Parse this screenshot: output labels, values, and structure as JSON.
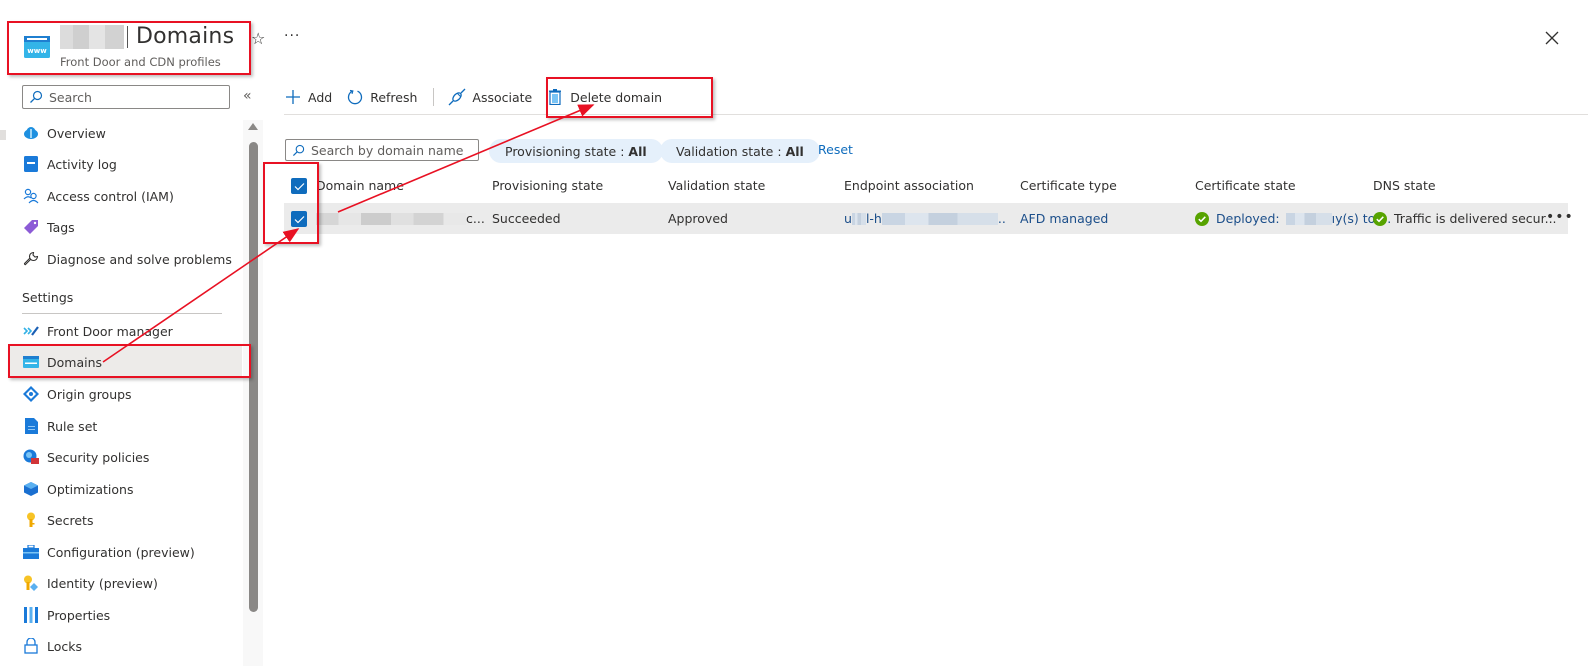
{
  "header": {
    "title": "Domains",
    "subtitle": "Front Door and CDN profiles",
    "resource_icon": "www-domain-icon",
    "favorite_icon": "star-icon",
    "more_icon": "ellipsis-icon",
    "close_icon": "close-icon",
    "favorite_glyph": "☆",
    "more_glyph": "···"
  },
  "sidebar": {
    "search_placeholder": "Search",
    "collapse_glyph": "«",
    "items": [
      {
        "label": "Overview",
        "icon": "cloud-icon"
      },
      {
        "label": "Activity log",
        "icon": "activity-log-icon"
      },
      {
        "label": "Access control (IAM)",
        "icon": "people-icon"
      },
      {
        "label": "Tags",
        "icon": "tag-icon"
      },
      {
        "label": "Diagnose and solve problems",
        "icon": "wrench-icon"
      }
    ],
    "section_settings": "Settings",
    "settings_items": [
      {
        "label": "Front Door manager",
        "icon": "front-door-icon"
      },
      {
        "label": "Domains",
        "icon": "www-domain-icon",
        "active": true
      },
      {
        "label": "Origin groups",
        "icon": "origin-groups-icon"
      },
      {
        "label": "Rule set",
        "icon": "document-icon"
      },
      {
        "label": "Security policies",
        "icon": "security-globe-icon"
      },
      {
        "label": "Optimizations",
        "icon": "cube-icon"
      },
      {
        "label": "Secrets",
        "icon": "key-icon"
      },
      {
        "label": "Configuration (preview)",
        "icon": "toolbox-icon"
      },
      {
        "label": "Identity (preview)",
        "icon": "identity-key-icon"
      },
      {
        "label": "Properties",
        "icon": "properties-icon"
      },
      {
        "label": "Locks",
        "icon": "lock-icon"
      }
    ]
  },
  "toolbar": {
    "add_label": "Add",
    "refresh_label": "Refresh",
    "associate_label": "Associate",
    "delete_label": "Delete domain"
  },
  "filters": {
    "search_placeholder": "Search by domain name",
    "provisioning_label": "Provisioning state :",
    "provisioning_value": "All",
    "validation_label": "Validation state :",
    "validation_value": "All",
    "reset_label": "Reset"
  },
  "grid": {
    "columns": [
      "Domain name",
      "Provisioning state",
      "Validation state",
      "Endpoint association",
      "Certificate type",
      "Certificate state",
      "DNS state"
    ],
    "select_all_checked": true,
    "rows": [
      {
        "checked": true,
        "domain_name_suffix": "c...",
        "provisioning_state": "Succeeded",
        "validation_state": "Approved",
        "endpoint_prefix": "u",
        "endpoint_mid": "l-h",
        "endpoint_suffix": "..",
        "certificate_type": "AFD managed",
        "certificate_state_prefix": "Deployed:",
        "certificate_state_suffix": "ıy(s) to ...",
        "dns_state": "Traffic is delivered secur...",
        "more_glyph": "•••"
      }
    ]
  },
  "colors": {
    "accent": "#0f6cbd",
    "link": "#1b4e8a",
    "success": "#57a300",
    "annotation": "#e81123",
    "selected_row": "#ebebeb",
    "pill_bg": "#e5f0fb"
  }
}
